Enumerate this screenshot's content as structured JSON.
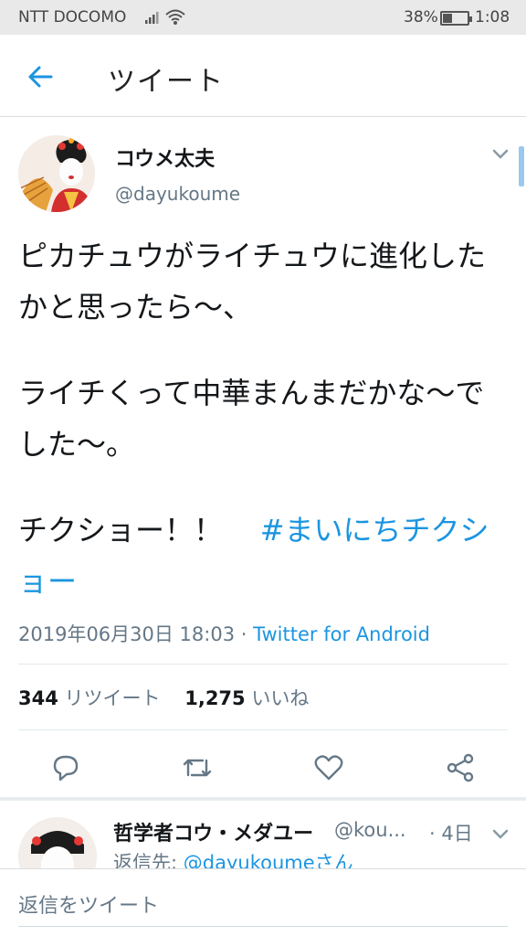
{
  "status_bar": {
    "carrier": "NTT DOCOMO",
    "battery_percent": "38%",
    "battery_level": 0.38,
    "time": "1:08"
  },
  "app_bar": {
    "title": "ツイート"
  },
  "tweet": {
    "author_name": "コウメ太夫",
    "author_handle": "@dayukoume",
    "body": {
      "line1": "ピカチュウがライチュウに進化したかと思ったら〜、",
      "line2": "ライチくって中華まんまだかな〜でした〜。",
      "line3_text": "チクショー！！",
      "hashtag": "#まいにちチクショー"
    },
    "timestamp": "2019年06月30日 18:03",
    "separator": "·",
    "source": "Twitter for Android",
    "retweet_count": "344",
    "retweet_label": "リツイート",
    "like_count": "1,275",
    "like_label": "いいね"
  },
  "reply": {
    "name": "哲学者コウ・メダユー",
    "handle": "@kou...",
    "time": "· 4日",
    "reply_to_label": "返信先:",
    "reply_to_mention": "@dayukoumeさん"
  },
  "composer": {
    "placeholder": "返信をツイート"
  },
  "colors": {
    "accent": "#1b95e0",
    "secondary_text": "#657786",
    "status_bar_bg": "#e9e9e9"
  },
  "icons": {
    "back": "arrow-left-icon",
    "caret": "chevron-down-icon",
    "reply": "reply-icon",
    "retweet": "retweet-icon",
    "like": "heart-icon",
    "share": "share-icon"
  }
}
